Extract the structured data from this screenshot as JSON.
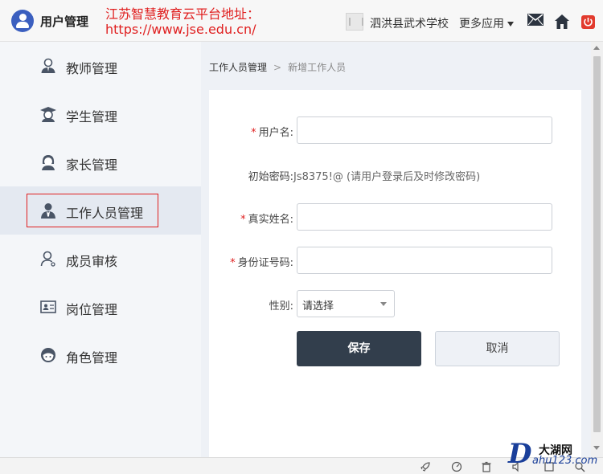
{
  "header": {
    "app_title": "用户管理",
    "notice_line1": "江苏智慧教育云平台地址：",
    "notice_line2": "https://www.jse.edu.cn/",
    "school_name": "泗洪县武术学校",
    "more_apps": "更多应用",
    "icons": [
      "user-avatar-icon",
      "school-icon",
      "mail-icon",
      "home-icon",
      "power-icon"
    ]
  },
  "sidebar": {
    "items": [
      {
        "label": "教师管理",
        "icon": "teacher-icon"
      },
      {
        "label": "学生管理",
        "icon": "student-cap-icon"
      },
      {
        "label": "家长管理",
        "icon": "parent-icon"
      },
      {
        "label": "工作人员管理",
        "icon": "staff-icon",
        "active": true
      },
      {
        "label": "成员审核",
        "icon": "member-review-icon"
      },
      {
        "label": "岗位管理",
        "icon": "id-card-icon"
      },
      {
        "label": "角色管理",
        "icon": "role-icon"
      }
    ]
  },
  "breadcrumb": {
    "first": "工作人员管理",
    "separator": ">",
    "current": "新增工作人员"
  },
  "form": {
    "username_label": "用户名:",
    "username_value": "",
    "initial_password_label": "初始密码:",
    "initial_password_value": "Js8375!@ (请用户登录后及时修改密码)",
    "realname_label": "真实姓名:",
    "realname_value": "",
    "idcard_label": "身份证号码:",
    "idcard_value": "",
    "gender_label": "性别:",
    "gender_selected": "请选择",
    "required_mark": "*",
    "save_label": "保存",
    "cancel_label": "取消"
  },
  "watermark": {
    "letter": "D",
    "name": "大湖网",
    "domain": "ahu123.com"
  },
  "colors": {
    "accent_red": "#e02020",
    "brand_blue": "#3b5fbf",
    "save_button": "#323e4c",
    "sidebar_active": "#e4e9f1"
  }
}
